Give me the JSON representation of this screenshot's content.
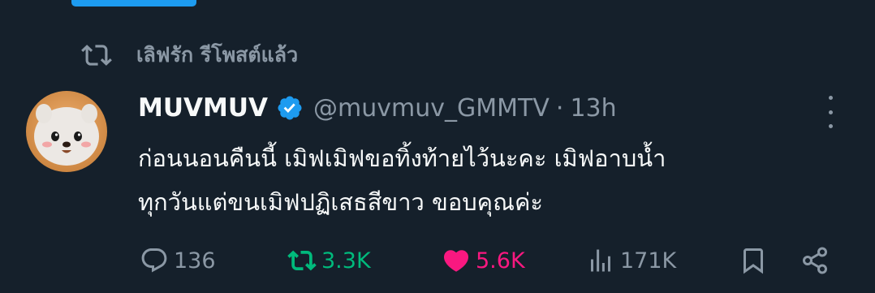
{
  "repost": {
    "label": "เลิฟรัก รีโพสต์แล้ว",
    "icon": "repost-icon"
  },
  "tweet": {
    "display_name": "MUVMUV",
    "verified": true,
    "handle": "@muvmuv_GMMTV",
    "separator": "·",
    "time": "13h",
    "text_lines": [
      "ก่อนนอนคืนนี้ เมิฟเมิฟขอทิ้งท้ายไว้นะคะ เมิฟอาบน้ำ",
      "ทุกวันแต่ขนเมิฟปฏิเสธสีขาว ขอบคุณค่ะ"
    ]
  },
  "actions": {
    "replies": "136",
    "reposts": "3.3K",
    "likes": "5.6K",
    "views": "171K"
  },
  "colors": {
    "background": "#15202b",
    "secondary_text": "#8b98a5",
    "accent_blue": "#1d9bf0",
    "repost_green": "#00ba7c",
    "like_pink": "#f91880"
  }
}
